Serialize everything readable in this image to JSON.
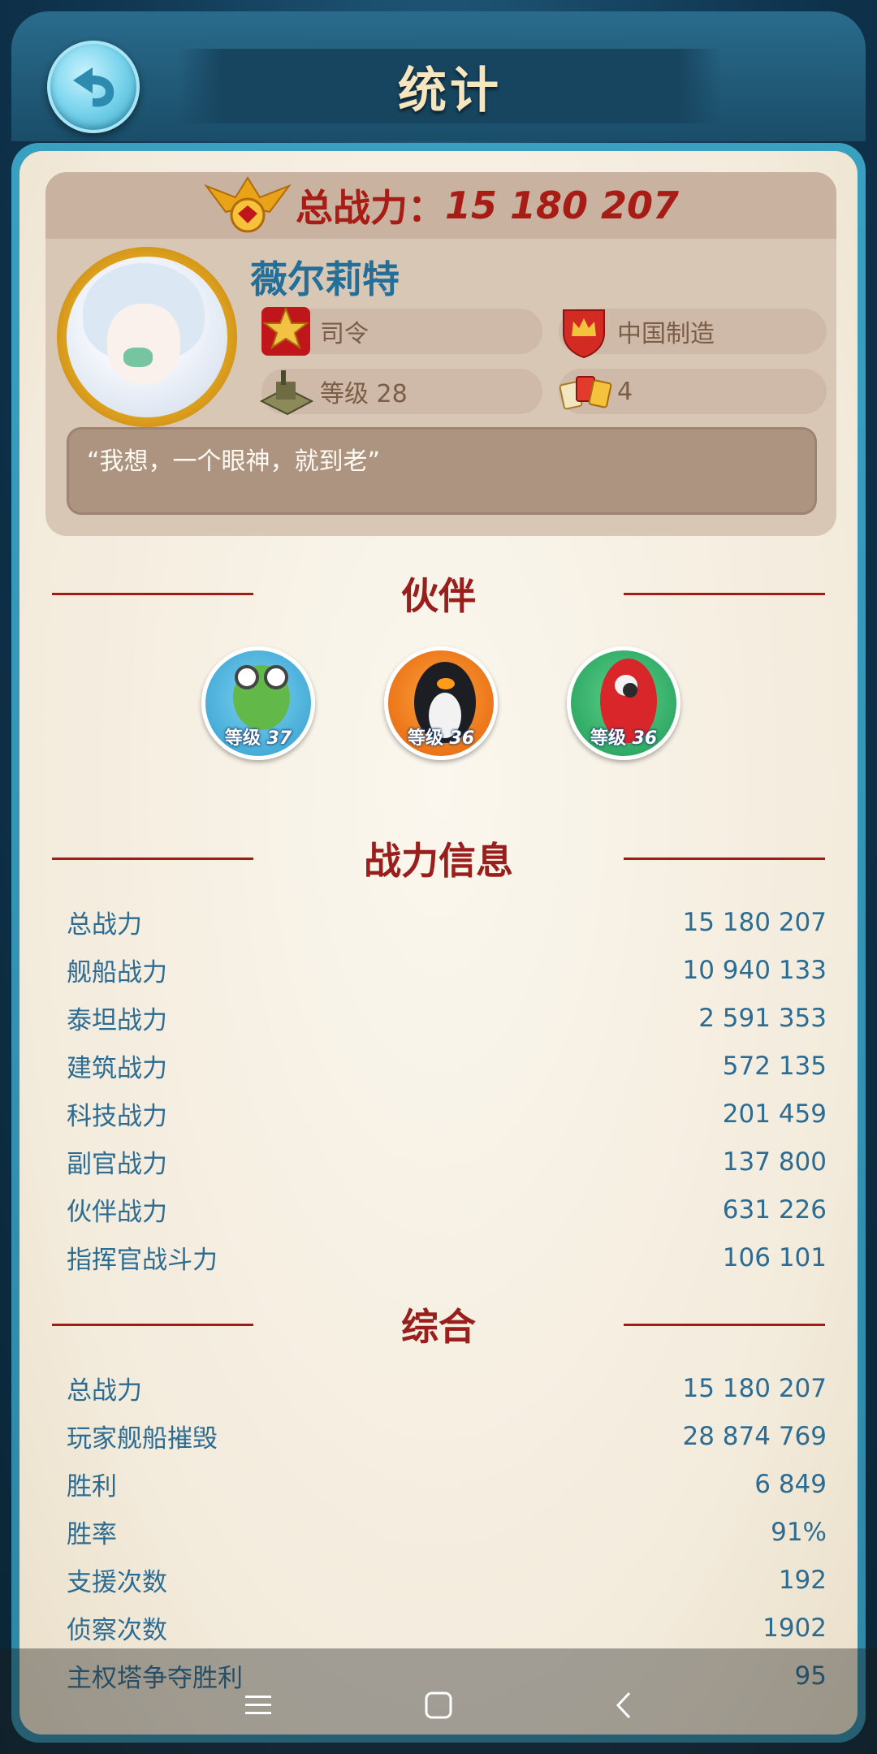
{
  "header": {
    "title": "统计"
  },
  "profile": {
    "total_power_label": "总战力：",
    "total_power_value": "15 180 207",
    "name": "薇尔莉特",
    "rank": "司令",
    "country": "中国制造",
    "level": "等级 28",
    "other_count": "4",
    "motto": "“我想，一个眼神，就到老”"
  },
  "sections": {
    "partners": "伙伴",
    "power_info": "战力信息",
    "overall": "综合"
  },
  "partners": [
    {
      "name": "turtle",
      "level_label": "等级",
      "level": "37"
    },
    {
      "name": "penguin",
      "level_label": "等级",
      "level": "36"
    },
    {
      "name": "parrot",
      "level_label": "等级",
      "level": "36"
    }
  ],
  "power_info": [
    {
      "label": "总战力",
      "value": "15 180 207"
    },
    {
      "label": "舰船战力",
      "value": "10 940 133"
    },
    {
      "label": "泰坦战力",
      "value": "2 591 353"
    },
    {
      "label": "建筑战力",
      "value": "572 135"
    },
    {
      "label": "科技战力",
      "value": "201 459"
    },
    {
      "label": "副官战力",
      "value": "137 800"
    },
    {
      "label": "伙伴战力",
      "value": "631 226"
    },
    {
      "label": "指挥官战斗力",
      "value": "106 101"
    }
  ],
  "overall": [
    {
      "label": "总战力",
      "value": "15 180 207"
    },
    {
      "label": "玩家舰船摧毁",
      "value": "28 874 769"
    },
    {
      "label": "胜利",
      "value": "6 849"
    },
    {
      "label": "胜率",
      "value": "91%"
    },
    {
      "label": "支援次数",
      "value": "192"
    },
    {
      "label": "侦察次数",
      "value": "1902"
    },
    {
      "label": "主权塔争夺胜利",
      "value": "95"
    }
  ],
  "colors": {
    "accent_red": "#9a1f1c",
    "stat_blue": "#2c6c92",
    "name_blue": "#236f99",
    "frame_teal": "#3aa0c0"
  },
  "icons": {
    "back": "back-arrow-icon",
    "power": "eagle-emblem-icon",
    "rank": "rank-star-badge-icon",
    "country": "crown-shield-icon",
    "level": "base-building-icon",
    "other": "cards-icon",
    "nav_menu": "menu-icon",
    "nav_home": "home-square-icon",
    "nav_back": "nav-back-icon"
  }
}
